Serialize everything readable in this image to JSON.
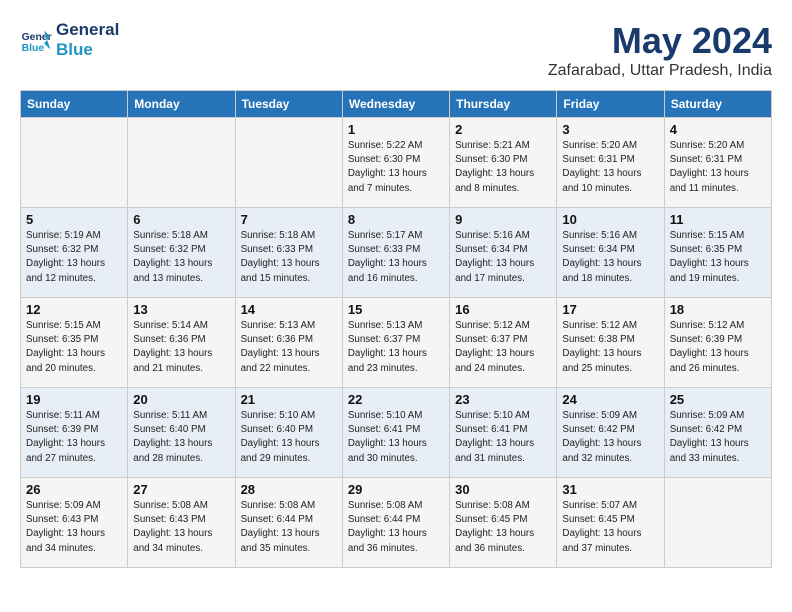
{
  "header": {
    "logo_line1": "General",
    "logo_line2": "Blue",
    "month": "May 2024",
    "location": "Zafarabad, Uttar Pradesh, India"
  },
  "weekdays": [
    "Sunday",
    "Monday",
    "Tuesday",
    "Wednesday",
    "Thursday",
    "Friday",
    "Saturday"
  ],
  "weeks": [
    [
      {
        "day": "",
        "info": ""
      },
      {
        "day": "",
        "info": ""
      },
      {
        "day": "",
        "info": ""
      },
      {
        "day": "1",
        "info": "Sunrise: 5:22 AM\nSunset: 6:30 PM\nDaylight: 13 hours\nand 7 minutes."
      },
      {
        "day": "2",
        "info": "Sunrise: 5:21 AM\nSunset: 6:30 PM\nDaylight: 13 hours\nand 8 minutes."
      },
      {
        "day": "3",
        "info": "Sunrise: 5:20 AM\nSunset: 6:31 PM\nDaylight: 13 hours\nand 10 minutes."
      },
      {
        "day": "4",
        "info": "Sunrise: 5:20 AM\nSunset: 6:31 PM\nDaylight: 13 hours\nand 11 minutes."
      }
    ],
    [
      {
        "day": "5",
        "info": "Sunrise: 5:19 AM\nSunset: 6:32 PM\nDaylight: 13 hours\nand 12 minutes."
      },
      {
        "day": "6",
        "info": "Sunrise: 5:18 AM\nSunset: 6:32 PM\nDaylight: 13 hours\nand 13 minutes."
      },
      {
        "day": "7",
        "info": "Sunrise: 5:18 AM\nSunset: 6:33 PM\nDaylight: 13 hours\nand 15 minutes."
      },
      {
        "day": "8",
        "info": "Sunrise: 5:17 AM\nSunset: 6:33 PM\nDaylight: 13 hours\nand 16 minutes."
      },
      {
        "day": "9",
        "info": "Sunrise: 5:16 AM\nSunset: 6:34 PM\nDaylight: 13 hours\nand 17 minutes."
      },
      {
        "day": "10",
        "info": "Sunrise: 5:16 AM\nSunset: 6:34 PM\nDaylight: 13 hours\nand 18 minutes."
      },
      {
        "day": "11",
        "info": "Sunrise: 5:15 AM\nSunset: 6:35 PM\nDaylight: 13 hours\nand 19 minutes."
      }
    ],
    [
      {
        "day": "12",
        "info": "Sunrise: 5:15 AM\nSunset: 6:35 PM\nDaylight: 13 hours\nand 20 minutes."
      },
      {
        "day": "13",
        "info": "Sunrise: 5:14 AM\nSunset: 6:36 PM\nDaylight: 13 hours\nand 21 minutes."
      },
      {
        "day": "14",
        "info": "Sunrise: 5:13 AM\nSunset: 6:36 PM\nDaylight: 13 hours\nand 22 minutes."
      },
      {
        "day": "15",
        "info": "Sunrise: 5:13 AM\nSunset: 6:37 PM\nDaylight: 13 hours\nand 23 minutes."
      },
      {
        "day": "16",
        "info": "Sunrise: 5:12 AM\nSunset: 6:37 PM\nDaylight: 13 hours\nand 24 minutes."
      },
      {
        "day": "17",
        "info": "Sunrise: 5:12 AM\nSunset: 6:38 PM\nDaylight: 13 hours\nand 25 minutes."
      },
      {
        "day": "18",
        "info": "Sunrise: 5:12 AM\nSunset: 6:39 PM\nDaylight: 13 hours\nand 26 minutes."
      }
    ],
    [
      {
        "day": "19",
        "info": "Sunrise: 5:11 AM\nSunset: 6:39 PM\nDaylight: 13 hours\nand 27 minutes."
      },
      {
        "day": "20",
        "info": "Sunrise: 5:11 AM\nSunset: 6:40 PM\nDaylight: 13 hours\nand 28 minutes."
      },
      {
        "day": "21",
        "info": "Sunrise: 5:10 AM\nSunset: 6:40 PM\nDaylight: 13 hours\nand 29 minutes."
      },
      {
        "day": "22",
        "info": "Sunrise: 5:10 AM\nSunset: 6:41 PM\nDaylight: 13 hours\nand 30 minutes."
      },
      {
        "day": "23",
        "info": "Sunrise: 5:10 AM\nSunset: 6:41 PM\nDaylight: 13 hours\nand 31 minutes."
      },
      {
        "day": "24",
        "info": "Sunrise: 5:09 AM\nSunset: 6:42 PM\nDaylight: 13 hours\nand 32 minutes."
      },
      {
        "day": "25",
        "info": "Sunrise: 5:09 AM\nSunset: 6:42 PM\nDaylight: 13 hours\nand 33 minutes."
      }
    ],
    [
      {
        "day": "26",
        "info": "Sunrise: 5:09 AM\nSunset: 6:43 PM\nDaylight: 13 hours\nand 34 minutes."
      },
      {
        "day": "27",
        "info": "Sunrise: 5:08 AM\nSunset: 6:43 PM\nDaylight: 13 hours\nand 34 minutes."
      },
      {
        "day": "28",
        "info": "Sunrise: 5:08 AM\nSunset: 6:44 PM\nDaylight: 13 hours\nand 35 minutes."
      },
      {
        "day": "29",
        "info": "Sunrise: 5:08 AM\nSunset: 6:44 PM\nDaylight: 13 hours\nand 36 minutes."
      },
      {
        "day": "30",
        "info": "Sunrise: 5:08 AM\nSunset: 6:45 PM\nDaylight: 13 hours\nand 36 minutes."
      },
      {
        "day": "31",
        "info": "Sunrise: 5:07 AM\nSunset: 6:45 PM\nDaylight: 13 hours\nand 37 minutes."
      },
      {
        "day": "",
        "info": ""
      }
    ]
  ]
}
